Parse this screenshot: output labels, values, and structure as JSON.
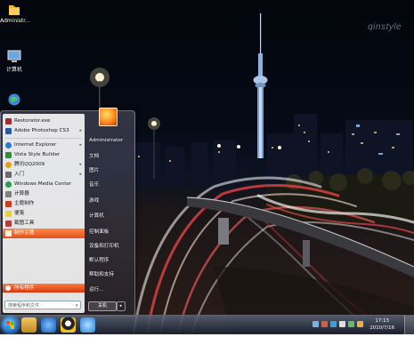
{
  "desktop": {
    "icons": [
      {
        "label": "Administr...",
        "icon": "folder-icon"
      },
      {
        "label": "计算机",
        "icon": "computer-icon"
      },
      {
        "label": "",
        "icon": "network-globe-icon"
      }
    ],
    "watermark": "qinstyle"
  },
  "start_menu": {
    "programs": [
      {
        "label": "Restorator.exe",
        "color": "#a03030",
        "arrow": ""
      },
      {
        "label": "Adobe Photoshop CS3",
        "color": "#2a5aa0",
        "arrow": "▸"
      },
      {
        "label": "Internet Explorer",
        "color": "#2a7ad0",
        "arrow": "▸"
      },
      {
        "label": "Vista Style Builder",
        "color": "#3a8a3a",
        "arrow": ""
      },
      {
        "label": "腾讯QQ2009",
        "color": "#e0a020",
        "arrow": "▸"
      },
      {
        "label": "入门",
        "color": "#6a6a6a",
        "arrow": "▸"
      },
      {
        "label": "Windows Media Center",
        "color": "#2a9a4a",
        "arrow": ""
      },
      {
        "label": "计算器",
        "color": "#808080",
        "arrow": ""
      },
      {
        "label": "主题制作",
        "color": "#c04020",
        "arrow": ""
      },
      {
        "label": "便笺",
        "color": "#e8d040",
        "arrow": ""
      },
      {
        "label": "截图工具",
        "color": "#b04040",
        "arrow": ""
      },
      {
        "label": "制作主题",
        "color": "#ff6a20",
        "arrow": "",
        "selected": true
      }
    ],
    "all_programs": "所有程序",
    "search_placeholder": "搜索程序和文件",
    "right_links": [
      "Administrator",
      "文档",
      "图片",
      "音乐",
      "游戏",
      "计算机",
      "控制面板",
      "设备和打印机",
      "默认程序",
      "帮助和支持",
      "运行..."
    ],
    "shutdown_label": "关机"
  },
  "taskbar": {
    "pinned": [
      {
        "name": "explorer",
        "color": "#d8a830"
      },
      {
        "name": "media-player",
        "color": "#2a7ad0"
      },
      {
        "name": "qq",
        "color": "#f0c020"
      },
      {
        "name": "internet-explorer",
        "color": "#3a90e0"
      }
    ],
    "clock_time": "17:13",
    "clock_date": "2010/7/16"
  }
}
